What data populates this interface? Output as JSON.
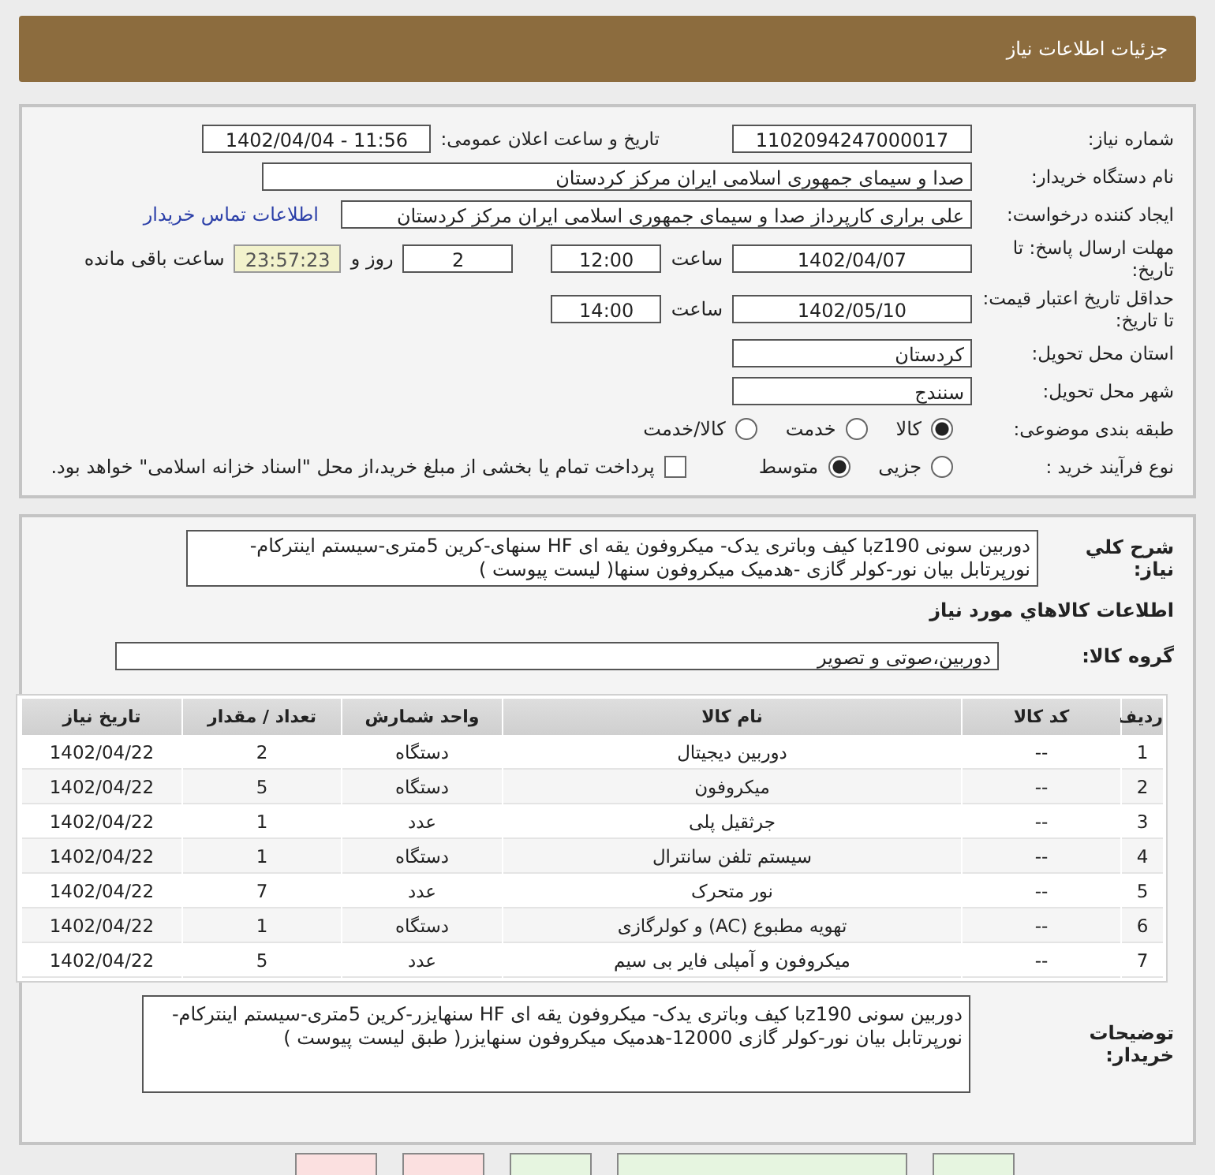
{
  "header": {
    "title": "جزئیات اطلاعات نیاز"
  },
  "details": {
    "need_number": {
      "label": "شماره نیاز:",
      "value": "1102094247000017"
    },
    "announce": {
      "label": "تاریخ و ساعت اعلان عمومی:",
      "value": "1402/04/04 - 11:56"
    },
    "buyer_org": {
      "label": "نام دستگاه خریدار:",
      "value": "صدا و سیمای جمهوری اسلامی ایران مرکز کردستان"
    },
    "creator": {
      "label": "ایجاد کننده درخواست:",
      "value": "علی براری کارپرداز صدا و سیمای جمهوری اسلامی ایران مرکز کردستان",
      "link": "اطلاعات تماس خریدار"
    },
    "deadline": {
      "label": "مهلت ارسال پاسخ: تا تاریخ:",
      "date": "1402/04/07",
      "time_label": "ساعت",
      "time": "12:00",
      "days": "2",
      "days_label": "روز و",
      "remaining": "23:57:23",
      "remaining_label": "ساعت باقی مانده"
    },
    "validity": {
      "label": "حداقل تاریخ اعتبار قیمت: تا تاریخ:",
      "date": "1402/05/10",
      "time_label": "ساعت",
      "time": "14:00"
    },
    "province": {
      "label": "استان محل تحویل:",
      "value": "کردستان"
    },
    "city": {
      "label": "شهر محل تحویل:",
      "value": "سنندج"
    },
    "category": {
      "label": "طبقه بندی موضوعی:",
      "options": [
        {
          "label": "کالا",
          "selected": true
        },
        {
          "label": "خدمت",
          "selected": false
        },
        {
          "label": "کالا/خدمت",
          "selected": false
        }
      ]
    },
    "process": {
      "label": "نوع فرآیند خرید :",
      "options": [
        {
          "label": "جزیی",
          "selected": false
        },
        {
          "label": "متوسط",
          "selected": true
        }
      ],
      "payment": {
        "label": "پرداخت تمام یا بخشی از مبلغ خرید،از محل \"اسناد خزانه اسلامی\" خواهد بود.",
        "checked": false
      }
    }
  },
  "summary": {
    "label": "شرح کلي نياز:",
    "text": "دوربین سونی z190با کیف وباتری یدک- میکروفون یقه ای HF سنهای-کرین 5متری-سیستم اینترکام-نورپرتابل بیان نور-کولر گازی -هدمیک میکروفون سنها(  لیست پیوست )"
  },
  "goods_title": "اطلاعات كالاهاي مورد نياز",
  "group": {
    "label": "گروه کالا:",
    "value": "دوربین،صوتی و تصویر"
  },
  "table": {
    "columns": [
      "ردیف",
      "کد کالا",
      "نام کالا",
      "واحد شمارش",
      "تعداد / مقدار",
      "تاریخ نیاز"
    ],
    "rows": [
      [
        "1",
        "--",
        "دوربین دیجیتال",
        "دستگاه",
        "2",
        "1402/04/22"
      ],
      [
        "2",
        "--",
        "میکروفون",
        "دستگاه",
        "5",
        "1402/04/22"
      ],
      [
        "3",
        "--",
        "جرثقیل پلی",
        "عدد",
        "1",
        "1402/04/22"
      ],
      [
        "4",
        "--",
        "سیستم تلفن سانترال",
        "دستگاه",
        "1",
        "1402/04/22"
      ],
      [
        "5",
        "--",
        "نور متحرک",
        "عدد",
        "7",
        "1402/04/22"
      ],
      [
        "6",
        "--",
        "تهویه مطبوع (AC) و کولرگازی",
        "دستگاه",
        "1",
        "1402/04/22"
      ],
      [
        "7",
        "--",
        "میکروفون و آمپلی فایر بی سیم",
        "عدد",
        "5",
        "1402/04/22"
      ]
    ]
  },
  "buyer_notes": {
    "label": "توضیحات خریدار:",
    "text": "دوربین سونی z190با کیف وباتری یدک- میکروفون یقه ای HF سنهایزر-کرین 5متری-سیستم اینترکام-نورپرتابل بیان نور-کولر گازی 12000-هدمیک میکروفون سنهایزر( طبق لیست پیوست )"
  },
  "buttons": [
    {
      "color": "#e6f5e0"
    },
    {
      "color": "#e6f5e0"
    },
    {
      "color": "#e6f5e0"
    },
    {
      "color": "#fbe0e0"
    },
    {
      "color": "#fbe0e0"
    }
  ]
}
